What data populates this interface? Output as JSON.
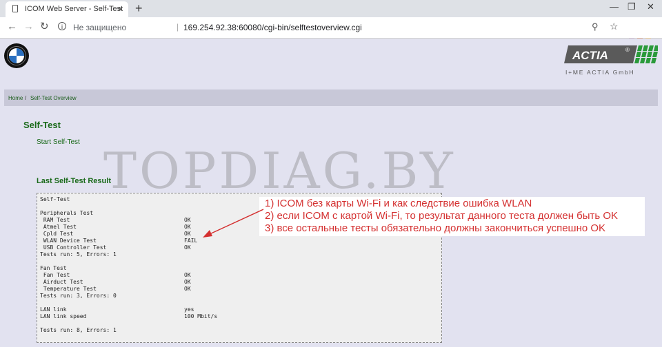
{
  "browser": {
    "tab_title": "ICOM Web Server - Self-Test",
    "new_tab": "+",
    "close_tab": "×",
    "win_min": "—",
    "win_restore": "❐",
    "win_close": "✕",
    "back": "←",
    "forward": "→",
    "reload": "↻",
    "insecure_label": "Не защищено",
    "url": "169.254.92.38:60080/cgi-bin/selftestoverview.cgi",
    "info": "i",
    "zoom": "⚲",
    "bookmark": "☆"
  },
  "header": {
    "actia_logo": "ACTIA",
    "actia_sub": "I+ME ACTIA GmbH"
  },
  "breadcrumb": {
    "home": "Home",
    "sep": "/",
    "current": "Self-Test Overview"
  },
  "main": {
    "section_title": "Self-Test",
    "start_link": "Start Self-Test",
    "result_title": "Last Self-Test Result"
  },
  "result": [
    {
      "label": "Self-Test",
      "value": ""
    },
    {
      "label": "",
      "value": ""
    },
    {
      "label": "Peripherals Test",
      "value": ""
    },
    {
      "label": " RAM Test",
      "value": "OK"
    },
    {
      "label": " Atmel Test",
      "value": "OK"
    },
    {
      "label": " Cpld Test",
      "value": "OK"
    },
    {
      "label": " WLAN Device Test",
      "value": "FAIL"
    },
    {
      "label": " USB Controller Test",
      "value": "OK"
    },
    {
      "label": "Tests run: 5, Errors: 1",
      "value": ""
    },
    {
      "label": "",
      "value": ""
    },
    {
      "label": "Fan Test",
      "value": ""
    },
    {
      "label": " Fan Test",
      "value": "OK"
    },
    {
      "label": " Airduct Test",
      "value": "OK"
    },
    {
      "label": " Temperature Test",
      "value": "OK"
    },
    {
      "label": "Tests run: 3, Errors: 0",
      "value": ""
    },
    {
      "label": "",
      "value": ""
    },
    {
      "label": "LAN link",
      "value": "yes"
    },
    {
      "label": "LAN link speed",
      "value": "100 Mbit/s"
    },
    {
      "label": "",
      "value": ""
    },
    {
      "label": "Tests run: 8, Errors: 1",
      "value": ""
    }
  ],
  "watermark": "TOPDIAG.BY",
  "annotation": [
    "1) ICOM без карты Wi-Fi и как следствие ошибка WLAN",
    "2) если ICOM с картой Wi-Fi, то результат данного теста должен быть OK",
    "3) все остальные тесты обязательно должны закончиться успешно OK"
  ],
  "colors": {
    "page_bg": "#e2e2f0",
    "link_green": "#1a6a1a",
    "annotation_red": "#d43030"
  }
}
